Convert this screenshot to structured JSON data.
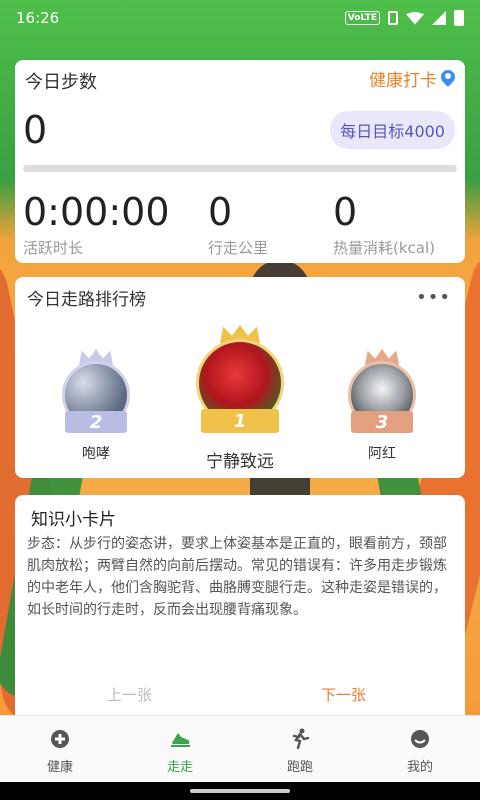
{
  "status_bar": {
    "time": "16:26",
    "network": "VoLTE"
  },
  "steps": {
    "title": "今日步数",
    "checkin_label": "健康打卡",
    "count": "0",
    "goal_label": "每日目标4000",
    "progress": 0,
    "metrics": [
      {
        "value": "0:00:00",
        "label": "活跃时长"
      },
      {
        "value": "0",
        "label": "行走公里"
      },
      {
        "value": "0",
        "label": "热量消耗(kcal)"
      }
    ]
  },
  "ranking": {
    "title": "今日走路排行榜",
    "more": "•••",
    "entries": [
      {
        "rank": "2",
        "name": "咆哮",
        "medal": "#b9bde2"
      },
      {
        "rank": "1",
        "name": "宁静致远",
        "medal": "#f0c24a"
      },
      {
        "rank": "3",
        "name": "阿红",
        "medal": "#e3a07e"
      }
    ]
  },
  "tips": {
    "title": "知识小卡片",
    "body": "步态：从步行的姿态讲，要求上体姿基本是正直的，眼看前方，颈部肌肉放松；两臂自然的向前后摆动。常见的错误有：许多用走步锻炼的中老年人，他们含胸驼背、曲胳膊变腿行走。这种走姿是错误的，如长时间的行走时，反而会出现腰背痛现象。",
    "prev_label": "上一张",
    "next_label": "下一张"
  },
  "nav": {
    "items": [
      {
        "label": "健康",
        "icon": "health-shield-icon"
      },
      {
        "label": "走走",
        "icon": "shoe-icon"
      },
      {
        "label": "跑跑",
        "icon": "runner-icon"
      },
      {
        "label": "我的",
        "icon": "profile-icon"
      }
    ],
    "active_index": 1
  },
  "colors": {
    "accent": "#e8822a",
    "green": "#3aa24a",
    "goal_bg": "#e9e8fb"
  }
}
